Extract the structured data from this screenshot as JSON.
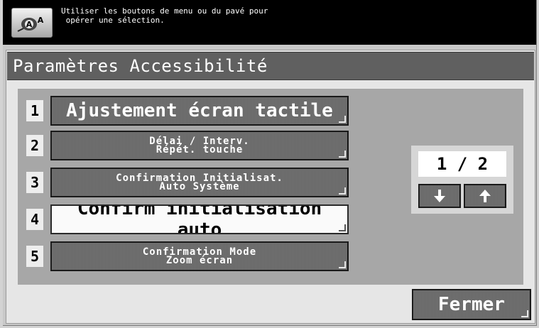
{
  "header": {
    "message": "Utiliser les boutons de menu ou du pavé pour\n opérer une sélection.",
    "icon": "accessibility-icon"
  },
  "title": "Paramètres Accessibilité",
  "menu": {
    "items": [
      {
        "number": "1",
        "label": "Ajustement écran tactile"
      },
      {
        "number": "2",
        "label": "Délai / Interv.\nRépét. touche"
      },
      {
        "number": "3",
        "label": "Confirmation Initialisat.\nAuto Système"
      },
      {
        "number": "4",
        "label": "Confirm initialisation auto"
      },
      {
        "number": "5",
        "label": "Confirmation Mode\nZoom écran"
      }
    ]
  },
  "pager": {
    "indicator": "1 / 2",
    "down_icon": "arrow-down-icon",
    "up_icon": "arrow-up-icon"
  },
  "footer": {
    "close_label": "Fermer"
  }
}
